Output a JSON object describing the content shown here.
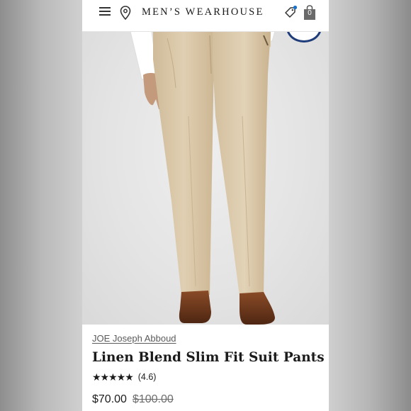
{
  "header": {
    "logo": "MEN’S WEARHOUSE",
    "bag_count": "0",
    "icons": [
      "menu-icon",
      "location-pin-icon",
      "tag-icon",
      "shopping-bag-icon"
    ],
    "notification_dot_color": "#1a73c8"
  },
  "product": {
    "brand": "JOE Joseph Abboud",
    "title": "Linen Blend Slim Fit Suit Pants",
    "rating_stars": "★★★★★",
    "rating_value": 4.6,
    "rating_text": "(4.6)",
    "price": "$70.00",
    "original_price": "$100.00",
    "image_description_colors": {
      "pants": "#d9c6a6",
      "shoes": "#6b3a1f",
      "shirt": "#ffffff"
    }
  }
}
